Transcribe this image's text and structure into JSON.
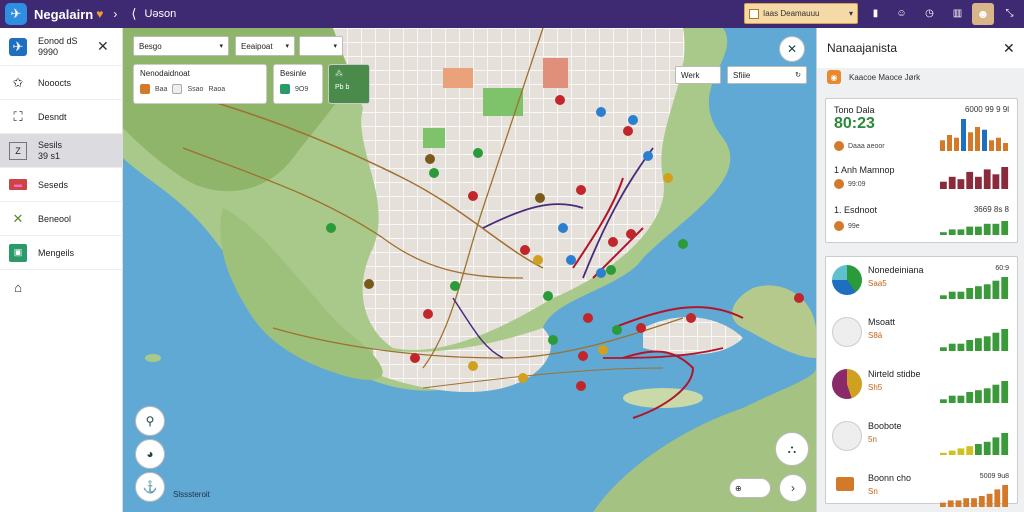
{
  "header": {
    "app_logo": "bird-icon",
    "title": "Negalairn",
    "crumb_label": "Uəson",
    "search_text": "Iaas Deamauuu",
    "icons": [
      "flag-icon",
      "profile-icon",
      "clock-icon",
      "bookmark-icon",
      "fullscreen-icon"
    ]
  },
  "sidebar": {
    "items": [
      {
        "label": "Eonod dS",
        "sub": "9990",
        "icon": "plane-icon",
        "color": "#2a7fd0"
      },
      {
        "label": "Nooocts",
        "sub": "",
        "icon": "star-icon",
        "color": "#333"
      },
      {
        "label": "Desndt",
        "sub": "",
        "icon": "map-icon",
        "color": "#333"
      },
      {
        "label": "Sesils",
        "sub": "39 s1",
        "icon": "grid-icon",
        "color": "#666",
        "active": true
      },
      {
        "label": "Seseds",
        "sub": "",
        "icon": "flag-icon",
        "color": "#c04040"
      },
      {
        "label": "Beneool",
        "sub": "",
        "icon": "leaf-icon",
        "color": "#5a8a2a"
      },
      {
        "label": "Mengeils",
        "sub": "",
        "icon": "case-icon",
        "color": "#2a9a6a"
      },
      {
        "label": "",
        "sub": "",
        "icon": "home-icon",
        "color": "#333"
      }
    ]
  },
  "map_controls": {
    "select1": "Besgo",
    "select2": "Eeaipoat",
    "select3": "",
    "card1": {
      "title": "Nenodaidnoat",
      "items": [
        "Baa",
        "Ssao",
        "Raoa"
      ]
    },
    "card2": {
      "title": "Besinle",
      "value": "9O9"
    },
    "card3": {
      "value": "Pb b"
    },
    "view_btn1": "Werk",
    "view_btn2": "Sfiiie",
    "caption": "Slsssteroit"
  },
  "right_panel": {
    "title": "Nanaajanista",
    "subtitle": "Kaacoe Maoce Jørk",
    "stats": [
      {
        "label": "Tono Dala",
        "big": "80:23",
        "meta": "Daaa aeoor",
        "range": "6000 99 9 9l",
        "bars": [
          4,
          6,
          5,
          12,
          7,
          9,
          8,
          4,
          5,
          3
        ]
      },
      {
        "label": "1 Anh Mamnop",
        "big": "",
        "meta": "99:09",
        "range": "",
        "bars": [
          3,
          5,
          4,
          7,
          5,
          8,
          6,
          9
        ]
      },
      {
        "label": "1. Esdnoot",
        "big": "",
        "meta": "99e",
        "range": "3669 8s 8",
        "bars": [
          1,
          2,
          2,
          3,
          3,
          4,
          4,
          5
        ]
      }
    ],
    "metrics": [
      {
        "title": "Nonedeiniana",
        "value": "Saa5",
        "rv": "60:9",
        "bars": [
          2,
          4,
          4,
          6,
          7,
          8,
          10,
          12
        ]
      },
      {
        "title": "Msoatt",
        "value": "S8ä",
        "rv": "",
        "bars": [
          2,
          4,
          4,
          6,
          7,
          8,
          10,
          12
        ]
      },
      {
        "title": "Nirteld stidbe",
        "value": "Sh5",
        "rv": "",
        "bars": [
          2,
          4,
          4,
          6,
          7,
          8,
          10,
          12
        ]
      },
      {
        "title": "Boobote",
        "value": "5n",
        "rv": "",
        "bars": [
          1,
          2,
          3,
          4,
          5,
          6,
          8,
          10
        ]
      },
      {
        "title": "Boonn cho",
        "value": "Sn",
        "rv": "5009 9u8",
        "bars": [
          2,
          3,
          3,
          4,
          4,
          5,
          6,
          8,
          10
        ]
      }
    ]
  },
  "colors": {
    "topbar": "#3e2a72",
    "water": "#5fa9d4",
    "land": "#b9cf8f",
    "route_red": "#b2162a",
    "route_purple": "#4a2a7a",
    "bar_green": "#3a9a3a",
    "bar_orange": "#d27a2a",
    "bar_maroon": "#8a2a3a"
  }
}
